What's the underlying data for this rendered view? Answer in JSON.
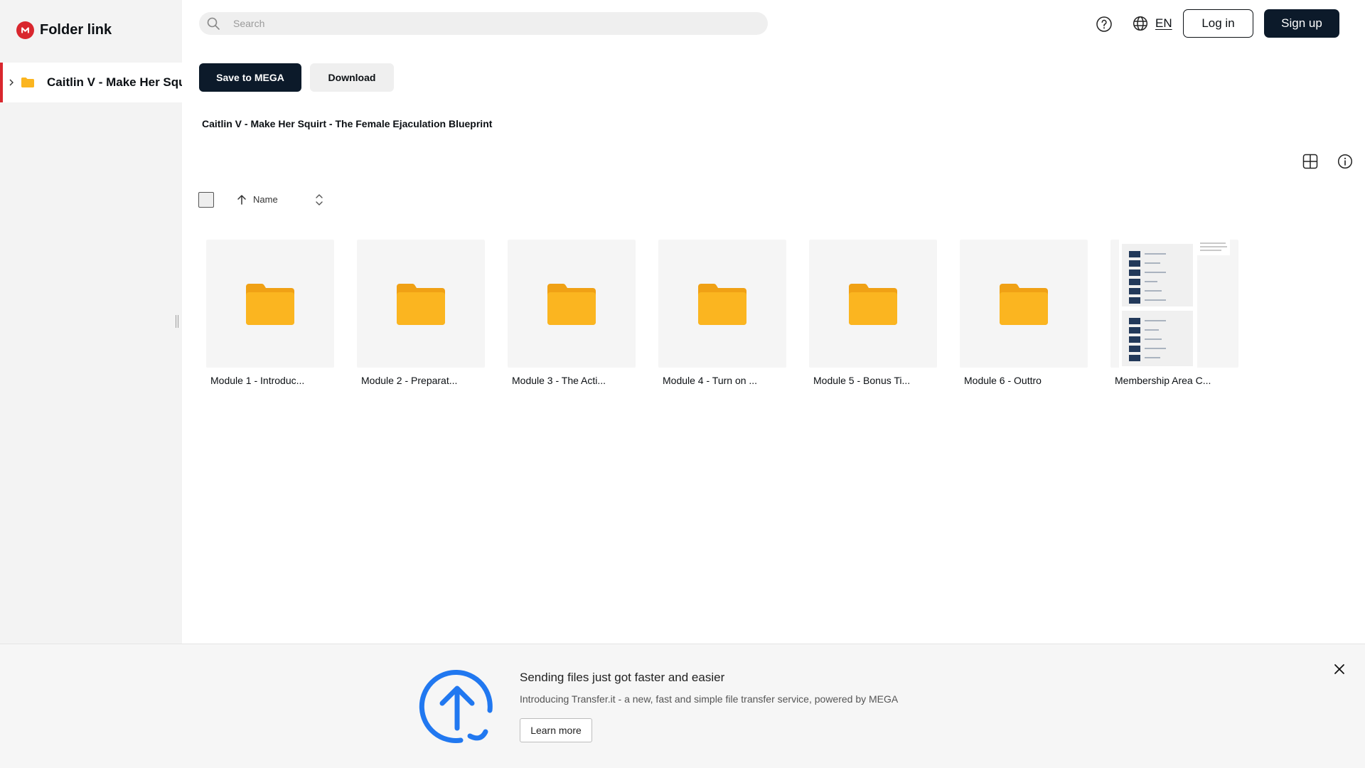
{
  "brand": {
    "title": "Folder link"
  },
  "sidebar": {
    "tree": [
      {
        "label": "Caitlin V - Make Her Squirt - The Female Ejaculation Blueprint"
      }
    ]
  },
  "header": {
    "search_placeholder": "Search",
    "language": "EN",
    "login_label": "Log in",
    "signup_label": "Sign up"
  },
  "toolbar": {
    "save_label": "Save to MEGA",
    "download_label": "Download"
  },
  "breadcrumb": "Caitlin V - Make Her Squirt - The Female Ejaculation Blueprint",
  "sort": {
    "label": "Name",
    "direction": "ascending"
  },
  "items": [
    {
      "name": "Module 1 - Introduc...",
      "type": "folder"
    },
    {
      "name": "Module 2 - Preparat...",
      "type": "folder"
    },
    {
      "name": "Module 3 - The Acti...",
      "type": "folder"
    },
    {
      "name": "Module 4 - Turn on ...",
      "type": "folder"
    },
    {
      "name": "Module 5 - Bonus Ti...",
      "type": "folder"
    },
    {
      "name": "Module 6 - Outtro",
      "type": "folder"
    },
    {
      "name": "Membership Area C...",
      "type": "image"
    }
  ],
  "banner": {
    "title": "Sending files just got faster and easier",
    "description": "Introducing Transfer.it - a new, fast and simple file transfer service, powered by MEGA",
    "button_label": "Learn more"
  },
  "colors": {
    "brand_red": "#d9272e",
    "dark_button": "#0c1a2a",
    "folder_yellow": "#fbb520",
    "banner_blue": "#2178f0"
  }
}
